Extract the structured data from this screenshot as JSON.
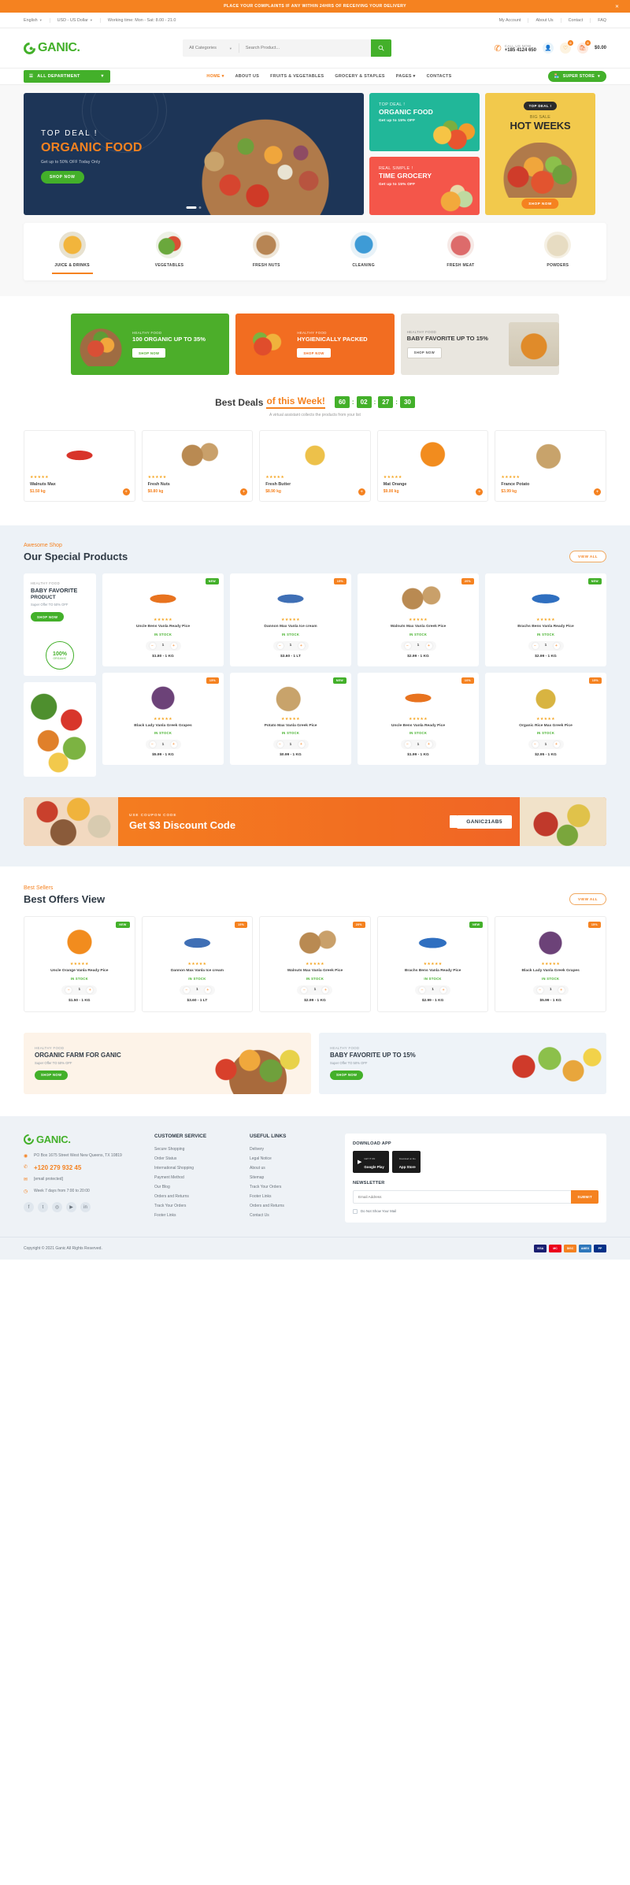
{
  "notice": {
    "text": "PLACE YOUR COMPLAINTS IF ANY WITHIN 24HRS OF RECEIVING YOUR DELIVERY",
    "close": "✕"
  },
  "topbar": {
    "language": "English",
    "currency": "USD - US Dollar",
    "working": "Working time: Mon - Sat: 8.00 - 21.0",
    "links": [
      "My Account",
      "About Us",
      "Contact",
      "FAQ"
    ]
  },
  "header": {
    "brand": "GANIC.",
    "search": {
      "category": "All Categories",
      "placeholder": "Search Product...",
      "icon": "search-icon"
    },
    "call_label": "CALL US NOW",
    "call_number": "+185 4124 650",
    "wishlist_count": "0",
    "cart_count": "0",
    "cart_total": "$0.00"
  },
  "nav": {
    "department": "ALL DEPARTMENT",
    "links": [
      "HOME",
      "ABOUT US",
      "FRUITS & VEGETABLES",
      "GROCERY & STAPLES",
      "PAGES",
      "CONTACTS"
    ],
    "active": "HOME",
    "superstore": "SUPER STORE"
  },
  "hero": {
    "main": {
      "sub": "TOP DEAL !",
      "title": "ORGANIC FOOD",
      "note": "Get up to 50% OFF  Today Only",
      "button": "SHOP NOW"
    },
    "mini1": {
      "sub": "TOP DEAL !",
      "title": "ORGANIC FOOD",
      "note": "Get up to 15% OFF"
    },
    "mini2": {
      "sub": "REAL SIMPLE !",
      "title": "TIME GROCERY",
      "note": "Get up to 15% OFF"
    },
    "right": {
      "tag": "TOP DEAL !",
      "sub": "BIG SALE",
      "title": "HOT WEEKS",
      "button": "SHOP NOW"
    }
  },
  "categories": [
    {
      "label": "JUICE & DRINKS",
      "icon": "juice-jar-icon",
      "active": true
    },
    {
      "label": "VEGETABLES",
      "icon": "vegetables-icon",
      "active": false
    },
    {
      "label": "FRESH NUTS",
      "icon": "nuts-icon",
      "active": false
    },
    {
      "label": "CLEANING",
      "icon": "cleaning-bottle-icon",
      "active": false
    },
    {
      "label": "FRESH MEAT",
      "icon": "meat-icon",
      "active": false
    },
    {
      "label": "POWDERS",
      "icon": "powder-icon",
      "active": false
    }
  ],
  "promos": [
    {
      "kicker": "HEALTHY FOOD",
      "title": "100 ORGANIC UP TO 35%",
      "button": "SHOP NOW",
      "theme": "green"
    },
    {
      "kicker": "HEALTHY FOOD",
      "title": "HYGIENICALLY PACKED",
      "button": "SHOP NOW",
      "theme": "orange"
    },
    {
      "kicker": "HEALTHY FOOD",
      "title": "BABY FAVORITE UP TO 15%",
      "button": "SHOP NOW",
      "theme": "gray"
    }
  ],
  "deals": {
    "title_a": "Best Deals",
    "title_b": "of this Week!",
    "subtitle": "A virtual assistant collects the products from your list",
    "timer": {
      "d": "60",
      "h": "02",
      "m": "27",
      "s": "30"
    },
    "products": [
      {
        "name": "Walnuts Max",
        "price": "$1.50 kg",
        "stars": "★★★★★",
        "img": "i-chili"
      },
      {
        "name": "Fresh Nuts",
        "price": "$0.80 kg",
        "stars": "★★★★★",
        "img": "i-nuts"
      },
      {
        "name": "Fresh Butter",
        "price": "$8.90 kg",
        "stars": "★★★★★",
        "img": "i-butter"
      },
      {
        "name": "Mat Orange",
        "price": "$9.00 kg",
        "stars": "★★★★★",
        "img": "i-orange"
      },
      {
        "name": "France Potato",
        "price": "$3.99 kg",
        "stars": "★★★★★",
        "img": "i-potato"
      }
    ],
    "plus": "+"
  },
  "special": {
    "kicker": "Awesome Shop",
    "title": "Our Special Products",
    "viewall": "VIEW ALL",
    "promo": {
      "kicker": "HEALTHY FOOD",
      "title1": "BABY FAVORITE",
      "title2": "PRODUCT",
      "note": "Super Offer TO 50% OFF",
      "button": "SHOP NOW",
      "seal_num": "100%",
      "seal_text": "ORGANIC"
    },
    "products": [
      {
        "name": "Uncle Bens Vanla Ready Pice",
        "stock": "IN STOCK",
        "qty": "1",
        "price": "$1.80 - 1 KG",
        "tag": "NEW",
        "tagType": "new",
        "img": "i-choco"
      },
      {
        "name": "Dannon Max Vanla Ice cream",
        "stock": "IN STOCK",
        "qty": "1",
        "price": "$3.60 - 1 LT",
        "tag": "15%",
        "tagType": "off",
        "img": "i-yog"
      },
      {
        "name": "Walnuts Max Vanla Greek Pice",
        "stock": "IN STOCK",
        "qty": "1",
        "price": "$2.99 - 1 KG",
        "tag": "20%",
        "tagType": "off",
        "img": "i-nuts"
      },
      {
        "name": "Brachs Bens Vanla Ready Pice",
        "stock": "IN STOCK",
        "qty": "1",
        "price": "$2.99 - 1 KG",
        "tag": "NEW",
        "tagType": "new",
        "img": "i-snack"
      },
      {
        "name": "Black Lady Vanla Greek Grapes",
        "stock": "IN STOCK",
        "qty": "1",
        "price": "$5.99 - 1 KG",
        "tag": "15%",
        "tagType": "off",
        "img": "i-grape"
      },
      {
        "name": "Potato Max Vanla Greek Pice",
        "stock": "IN STOCK",
        "qty": "1",
        "price": "$0.99 - 1 KG",
        "tag": "NEW",
        "tagType": "new",
        "img": "i-potato"
      },
      {
        "name": "Uncle Bens Vanla Ready Pice",
        "stock": "IN STOCK",
        "qty": "1",
        "price": "$1.99 - 1 KG",
        "tag": "10%",
        "tagType": "off",
        "img": "i-choco"
      },
      {
        "name": "Organic Rice Max Greek Pice",
        "stock": "IN STOCK",
        "qty": "1",
        "price": "$2.95 - 1 KG",
        "tag": "15%",
        "tagType": "off",
        "img": "i-jar"
      }
    ]
  },
  "coupon": {
    "kicker": "USE COUPON CODE",
    "title": "Get $3 Discount Code",
    "code": "GANIC21AB5"
  },
  "best": {
    "kicker": "Best Sellers",
    "title": "Best Offers View",
    "viewall": "VIEW ALL",
    "products": [
      {
        "name": "Uncle Orange Vanla Ready Pice",
        "stock": "IN STOCK",
        "qty": "1",
        "price": "$1.50 - 1 KG",
        "tag": "NEW",
        "tagType": "new",
        "img": "i-orange"
      },
      {
        "name": "Dannon Max Vanla Ice cream",
        "stock": "IN STOCK",
        "qty": "1",
        "price": "$3.60 - 1 LT",
        "tag": "15%",
        "tagType": "off",
        "img": "i-yog"
      },
      {
        "name": "Walnuts Max Vanla Greek Pice",
        "stock": "IN STOCK",
        "qty": "1",
        "price": "$2.99 - 1 KG",
        "tag": "20%",
        "tagType": "off",
        "img": "i-nuts"
      },
      {
        "name": "Brachs Bens Vanla Ready Pice",
        "stock": "IN STOCK",
        "qty": "1",
        "price": "$2.99 - 1 KG",
        "tag": "NEW",
        "tagType": "new",
        "img": "i-snack"
      },
      {
        "name": "Black Lady Vanla Greek Grapes",
        "stock": "IN STOCK",
        "qty": "1",
        "price": "$5.99 - 1 KG",
        "tag": "15%",
        "tagType": "off",
        "img": "i-grape"
      }
    ]
  },
  "bottom_banners": [
    {
      "kicker": "HEALTHY FOOD",
      "title": "ORGANIC FARM FOR GANIC",
      "note": "Super Offer TO 50% OFF",
      "button": "SHOP NOW"
    },
    {
      "kicker": "HEALTHY FOOD",
      "title": "BABY FAVORITE UP TO 15%",
      "note": "Super Offer TO 50% OFF",
      "button": "SHOP NOW"
    }
  ],
  "footer": {
    "brand": "GANIC.",
    "address": "PO Box 1675 Street West New Queens, TX 10819",
    "phone": "+120 279 932 45",
    "email": "[email protected]",
    "hours": "Week 7 days from 7:00 to 20:00",
    "socials": [
      "facebook-icon",
      "twitter-icon",
      "instagram-icon",
      "youtube-icon",
      "linkedin-icon"
    ],
    "col2": {
      "heading": "CUSTOMER SERVICE",
      "items": [
        "Secure Shopping",
        "Order Status",
        "International Shopping",
        "Payment Method",
        "Our Blog",
        "Orders and Returns",
        "Track Your Orders",
        "Footer Links"
      ]
    },
    "col3": {
      "heading": "USEFUL LINKS",
      "items": [
        "Delivery",
        "Legal Notice",
        "About us",
        "Sitemap",
        "Track Your Orders",
        "Footer Links",
        "Orders and Returns",
        "Contact Us"
      ]
    },
    "download": {
      "heading": "DOWNLOAD APP",
      "google": {
        "top": "GET IT ON",
        "main": "Google Play"
      },
      "apple": {
        "top": "Download on the",
        "main": "App Store"
      }
    },
    "newsletter": {
      "heading": "NEWSLETTER",
      "placeholder": "Email Address",
      "button": "SUBMIT",
      "checkbox_label": "Do Not Show Your Mail"
    },
    "copyright": "Copyright © 2021 Ganic All Rights Reserved.",
    "cards": [
      "VISA",
      "MC",
      "DISC",
      "AMEX",
      "PP"
    ]
  }
}
